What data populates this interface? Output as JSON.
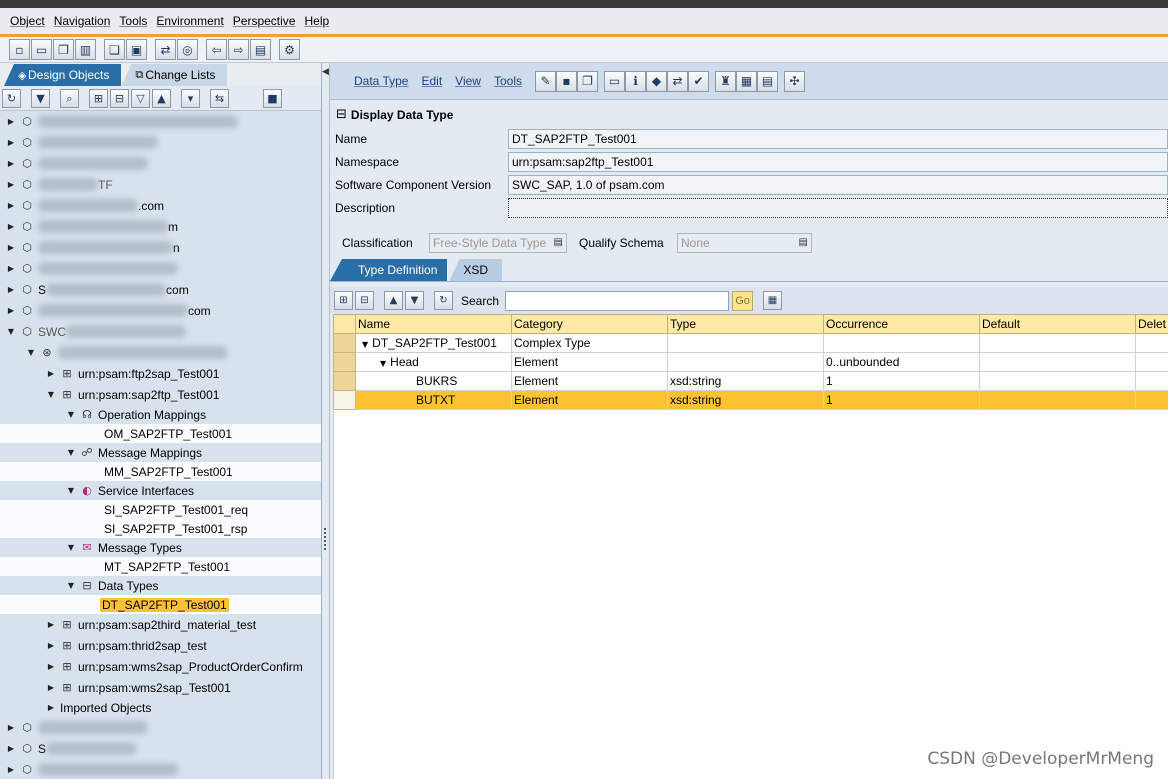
{
  "menubar": {
    "items": [
      "Object",
      "Navigation",
      "Tools",
      "Environment",
      "Perspective",
      "Help"
    ]
  },
  "left_panel": {
    "tabs": [
      {
        "label": "Design Objects",
        "active": true
      },
      {
        "label": "Change Lists",
        "active": false
      }
    ],
    "tree": {
      "visible_fragments": [
        ".com",
        "n",
        "m",
        "com",
        "com",
        "TF",
        "S",
        "S",
        "SWC"
      ],
      "namespaces": [
        "urn:psam:ftp2sap_Test001",
        "urn:psam:sap2ftp_Test001",
        "urn:psam:sap2third_material_test",
        "urn:psam:thrid2sap_test",
        "urn:psam:wms2sap_ProductOrderConfirm",
        "urn:psam:wms2sap_Test001"
      ],
      "folders": {
        "operation_mappings": "Operation Mappings",
        "message_mappings": "Message Mappings",
        "service_interfaces": "Service Interfaces",
        "message_types": "Message Types",
        "data_types": "Data Types"
      },
      "leaves": {
        "om": "OM_SAP2FTP_Test001",
        "mm": "MM_SAP2FTP_Test001",
        "si_req": "SI_SAP2FTP_Test001_req",
        "si_rsp": "SI_SAP2FTP_Test001_rsp",
        "mt": "MT_SAP2FTP_Test001",
        "dt": "DT_SAP2FTP_Test001"
      },
      "imported": "Imported Objects"
    }
  },
  "right_panel": {
    "menu": [
      "Data Type",
      "Edit",
      "View",
      "Tools"
    ],
    "title": "Display Data Type",
    "fields": {
      "name_label": "Name",
      "name_value": "DT_SAP2FTP_Test001",
      "namespace_label": "Namespace",
      "namespace_value": "urn:psam:sap2ftp_Test001",
      "scv_label": "Software Component Version",
      "scv_value": "SWC_SAP, 1.0 of psam.com",
      "description_label": "Description",
      "description_value": ""
    },
    "classification_label": "Classification",
    "classification_value": "Free-Style Data Type",
    "qualify_label": "Qualify Schema",
    "qualify_value": "None",
    "tabs": [
      {
        "label": "Type Definition",
        "active": true
      },
      {
        "label": "XSD",
        "active": false
      }
    ],
    "search_label": "Search",
    "search_value": "",
    "go_label": "Go",
    "grid": {
      "columns": [
        "Name",
        "Category",
        "Type",
        "Occurrence",
        "Default",
        "Delet"
      ],
      "rows": [
        {
          "name": "DT_SAP2FTP_Test001",
          "category": "Complex Type",
          "type": "",
          "occurrence": "",
          "default": "",
          "delete": ""
        },
        {
          "name": "Head",
          "category": "Element",
          "type": "",
          "occurrence": "0..unbounded",
          "default": "",
          "delete": ""
        },
        {
          "name": "BUKRS",
          "category": "Element",
          "type": "xsd:string",
          "occurrence": "1",
          "default": "",
          "delete": ""
        },
        {
          "name": "BUTXT",
          "category": "Element",
          "type": "xsd:string",
          "occurrence": "1",
          "default": "",
          "delete": ""
        }
      ]
    }
  },
  "watermark": "CSDN @DeveloperMrMeng",
  "colors": {
    "selection": "#ffc233",
    "accent_orange": "#f0a022",
    "tab_blue": "#2a6ea8",
    "panel_bg": "#d7e2ec"
  }
}
